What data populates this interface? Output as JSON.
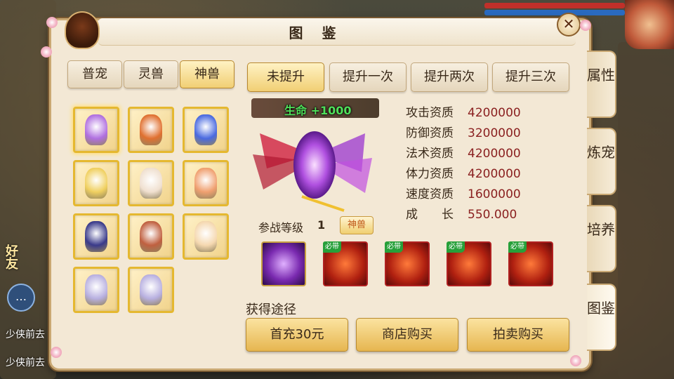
{
  "panel": {
    "title": "图 鉴",
    "close_label": "✕"
  },
  "left_tabs": [
    {
      "label": "普宠",
      "active": false
    },
    {
      "label": "灵兽",
      "active": false
    },
    {
      "label": "神兽",
      "active": true
    }
  ],
  "pets": [
    {
      "id": "pet-1",
      "color": "#b070e0",
      "selected": true
    },
    {
      "id": "pet-2",
      "color": "#e07030"
    },
    {
      "id": "pet-3",
      "color": "#4a6ae0"
    },
    {
      "id": "pet-4",
      "color": "#f0d060"
    },
    {
      "id": "pet-5",
      "color": "#f0e0d0"
    },
    {
      "id": "pet-6",
      "color": "#f0a070"
    },
    {
      "id": "pet-7",
      "color": "#3a3a8a"
    },
    {
      "id": "pet-8",
      "color": "#c06040"
    },
    {
      "id": "pet-9",
      "color": "#f5d8b0"
    },
    {
      "id": "pet-10",
      "color": "#b8b0e0"
    },
    {
      "id": "pet-11",
      "color": "#b8b0e0"
    }
  ],
  "upgrade_tabs": [
    {
      "label": "未提升",
      "active": true
    },
    {
      "label": "提升一次",
      "active": false
    },
    {
      "label": "提升两次",
      "active": false
    },
    {
      "label": "提升三次",
      "active": false
    }
  ],
  "buff": {
    "text": "生命 +1000"
  },
  "stats": [
    {
      "label": "攻击资质",
      "value": "4200000"
    },
    {
      "label": "防御资质",
      "value": "3200000"
    },
    {
      "label": "法术资质",
      "value": "4200000"
    },
    {
      "label": "体力资质",
      "value": "4200000"
    },
    {
      "label": "速度资质",
      "value": "1600000"
    },
    {
      "label": "成　　长",
      "value": "550.000"
    }
  ],
  "battle": {
    "label": "参战等级",
    "level": "1",
    "tag": "神兽"
  },
  "skills": [
    {
      "tag": "",
      "style": "purple"
    },
    {
      "tag": "必带",
      "style": "red"
    },
    {
      "tag": "必带",
      "style": "red"
    },
    {
      "tag": "必带",
      "style": "red"
    },
    {
      "tag": "必带",
      "style": "red"
    }
  ],
  "acquire": {
    "label": "获得途径",
    "buttons": [
      "首充30元",
      "商店购买",
      "拍卖购买"
    ]
  },
  "right_tabs": [
    {
      "label": "属性",
      "active": false
    },
    {
      "label": "炼宠",
      "active": false
    },
    {
      "label": "培养",
      "active": false
    },
    {
      "label": "图鉴",
      "active": true
    }
  ],
  "background": {
    "chat_lines": [
      "少侠前去",
      "少侠前去"
    ],
    "side_text": "好友"
  }
}
